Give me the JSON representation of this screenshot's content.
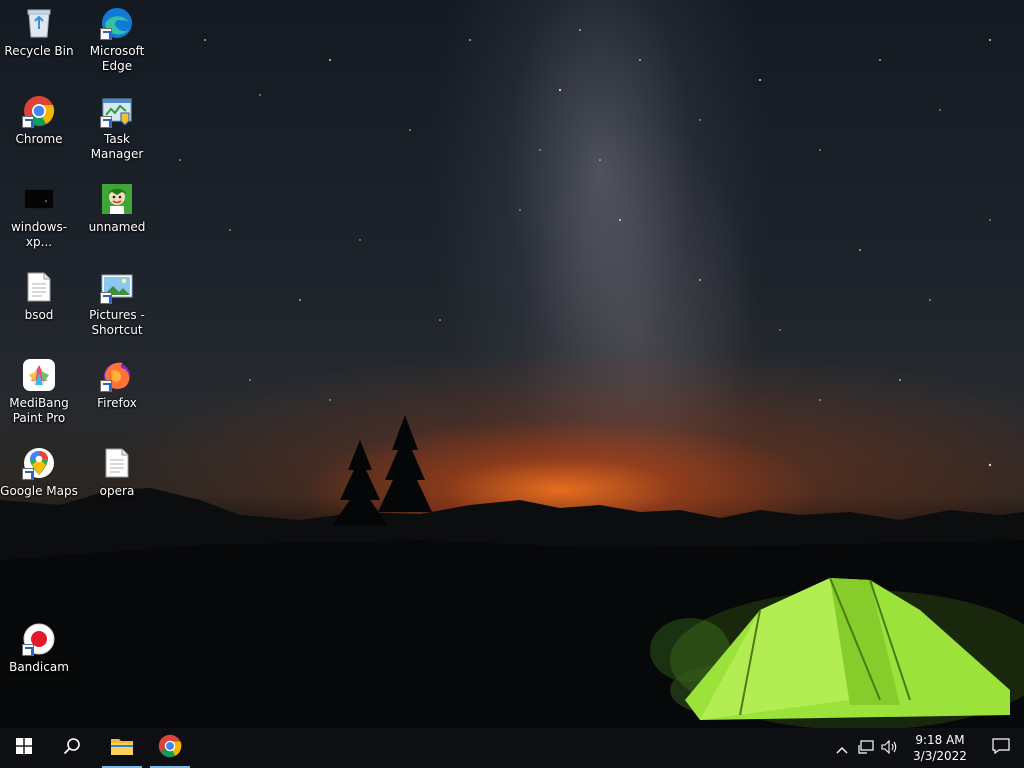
{
  "desktop": {
    "icons": [
      {
        "id": "recycle-bin",
        "label": "Recycle Bin",
        "icon": "recycle-bin-icon",
        "shortcut": false
      },
      {
        "id": "microsoft-edge",
        "label": "Microsoft Edge",
        "icon": "edge-icon",
        "shortcut": true
      },
      {
        "id": "chrome",
        "label": "Chrome",
        "icon": "chrome-icon",
        "shortcut": true
      },
      {
        "id": "task-manager",
        "label": "Task Manager",
        "icon": "task-manager-icon",
        "shortcut": true
      },
      {
        "id": "windows-xp",
        "label": "windows-xp...",
        "icon": "image-file-icon",
        "shortcut": false
      },
      {
        "id": "unnamed",
        "label": "unnamed",
        "icon": "image-file-icon",
        "shortcut": false
      },
      {
        "id": "bsod",
        "label": "bsod",
        "icon": "text-file-icon",
        "shortcut": false
      },
      {
        "id": "pictures-shortcut",
        "label": "Pictures - Shortcut",
        "icon": "pictures-folder-icon",
        "shortcut": true
      },
      {
        "id": "medibang",
        "label": "MediBang Paint Pro",
        "icon": "medibang-icon",
        "shortcut": false
      },
      {
        "id": "firefox",
        "label": "Firefox",
        "icon": "firefox-icon",
        "shortcut": true
      },
      {
        "id": "google-maps",
        "label": "Google Maps",
        "icon": "google-maps-icon",
        "shortcut": true
      },
      {
        "id": "opera",
        "label": "opera",
        "icon": "text-file-icon",
        "shortcut": false
      },
      {
        "id": "bandicam",
        "label": "Bandicam",
        "icon": "bandicam-icon",
        "shortcut": true
      }
    ]
  },
  "taskbar": {
    "start": {
      "icon": "windows-logo-icon"
    },
    "search": {
      "icon": "search-icon"
    },
    "pinned": [
      {
        "id": "file-explorer",
        "icon": "folder-icon",
        "active": true
      },
      {
        "id": "chrome",
        "icon": "chrome-icon",
        "active": true
      }
    ],
    "tray": {
      "icons": [
        "chevron-up-icon",
        "network-icon",
        "volume-icon"
      ],
      "time": "9:18 AM",
      "date": "3/3/2022",
      "notification_icon": "notification-icon"
    }
  },
  "colors": {
    "taskbar_bg": "#0d0f12",
    "active_indicator": "#76b9ed",
    "tent_green": "#9be23a"
  }
}
